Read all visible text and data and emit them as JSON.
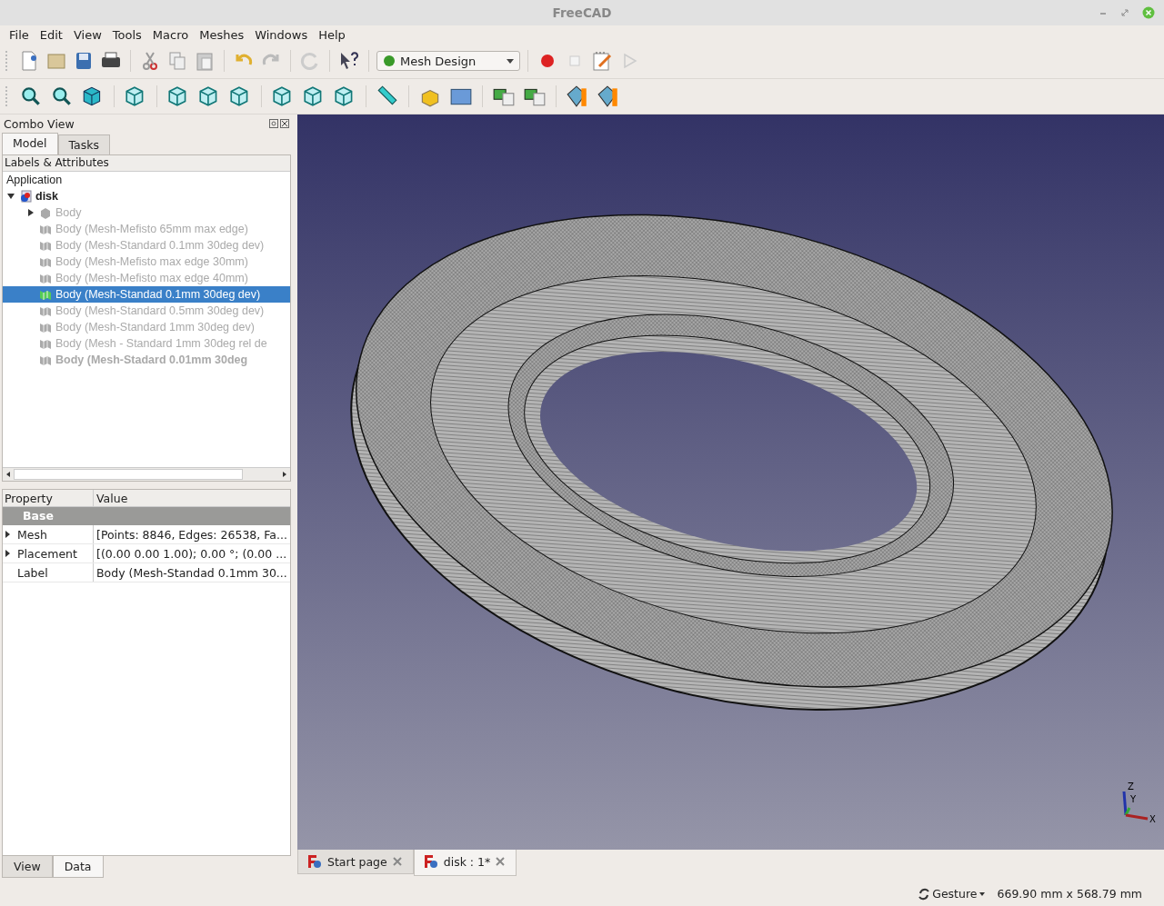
{
  "window": {
    "title": "FreeCAD"
  },
  "menu": [
    "File",
    "Edit",
    "View",
    "Tools",
    "Macro",
    "Meshes",
    "Windows",
    "Help"
  ],
  "workbench": {
    "value": "Mesh Design"
  },
  "combo_view": {
    "title": "Combo View",
    "tabs": [
      {
        "label": "Model",
        "selected": true
      },
      {
        "label": "Tasks",
        "selected": false
      }
    ],
    "tree_header": "Labels & Attributes",
    "root": "Application",
    "document": {
      "label": "disk",
      "expanded": true,
      "children": [
        {
          "label": "Body",
          "kind": "group",
          "expanded": false,
          "hidden": true,
          "selected": false,
          "bold": false
        },
        {
          "label": "Body (Mesh-Mefisto 65mm max edge)",
          "kind": "mesh",
          "hidden": true,
          "selected": false,
          "bold": false
        },
        {
          "label": "Body (Mesh-Standard 0.1mm 30deg dev)",
          "kind": "mesh",
          "hidden": true,
          "selected": false,
          "bold": false
        },
        {
          "label": "Body (Mesh-Mefisto max edge 30mm)",
          "kind": "mesh",
          "hidden": true,
          "selected": false,
          "bold": false
        },
        {
          "label": "Body (Mesh-Mefisto max edge 40mm)",
          "kind": "mesh",
          "hidden": true,
          "selected": false,
          "bold": false
        },
        {
          "label": "Body (Mesh-Standad 0.1mm 30deg dev)",
          "kind": "mesh",
          "hidden": false,
          "selected": true,
          "bold": false
        },
        {
          "label": "Body (Mesh-Standard 0.5mm 30deg dev)",
          "kind": "mesh",
          "hidden": true,
          "selected": false,
          "bold": false
        },
        {
          "label": "Body (Mesh-Standard 1mm 30deg dev)",
          "kind": "mesh",
          "hidden": true,
          "selected": false,
          "bold": false
        },
        {
          "label": "Body (Mesh - Standard 1mm 30deg rel de",
          "kind": "mesh",
          "hidden": true,
          "selected": false,
          "bold": false
        },
        {
          "label": "Body (Mesh-Stadard 0.01mm 30deg",
          "kind": "mesh",
          "hidden": true,
          "selected": false,
          "bold": true
        }
      ]
    }
  },
  "properties": {
    "columns": [
      "Property",
      "Value"
    ],
    "group": "Base",
    "rows": [
      {
        "name": "Mesh",
        "value": "[Points: 8846, Edges: 26538, Fa...",
        "expandable": true
      },
      {
        "name": "Placement",
        "value": "[(0.00 0.00 1.00); 0.00 °; (0.00 ...",
        "expandable": true
      },
      {
        "name": "Label",
        "value": "Body (Mesh-Standad 0.1mm 30...",
        "expandable": false
      }
    ],
    "tabs": [
      {
        "label": "View",
        "selected": false
      },
      {
        "label": "Data",
        "selected": true
      }
    ]
  },
  "viewport": {
    "axes": [
      "Z",
      "Y",
      "X"
    ]
  },
  "document_tabs": [
    {
      "label": "Start page",
      "selected": false
    },
    {
      "label": "disk : 1*",
      "selected": true
    }
  ],
  "status_bar": {
    "navigation": "Gesture",
    "dimensions": "669.90 mm x 568.79 mm"
  }
}
